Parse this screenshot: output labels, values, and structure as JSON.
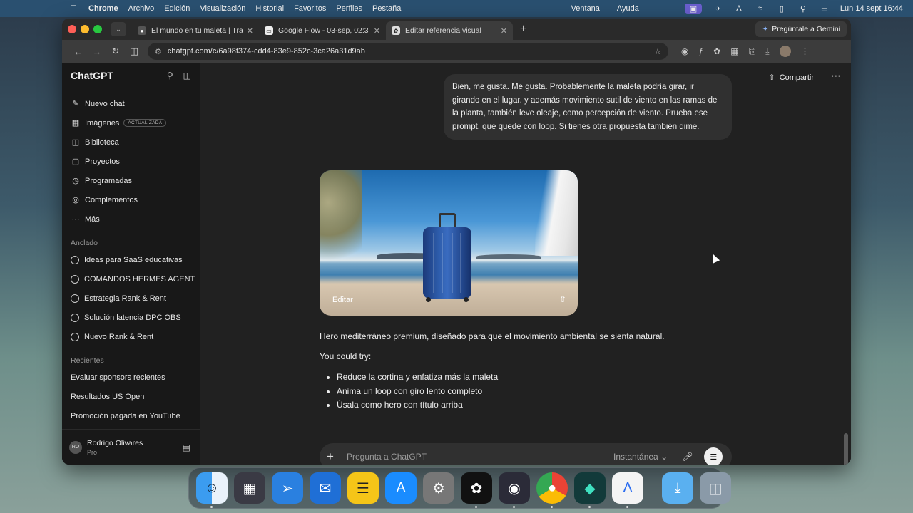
{
  "menubar": {
    "app": "Chrome",
    "items": [
      "Archivo",
      "Edición",
      "Visualización",
      "Historial",
      "Favoritos",
      "Perfiles",
      "Pestaña",
      "Ventana",
      "Ayuda"
    ],
    "clock": "Lun 14 sept  16:44"
  },
  "browser": {
    "tabs": [
      {
        "title": "El mundo en tu maleta | Trave",
        "favicon": "globe-icon"
      },
      {
        "title": "Google Flow - 03-sep, 02:33",
        "favicon": "flow-icon"
      },
      {
        "title": "Editar referencia visual",
        "favicon": "chatgpt-icon"
      }
    ],
    "gemini_label": "Pregúntale a Gemini",
    "url": "chatgpt.com/c/6a98f374-cdd4-83e9-852c-3ca26a31d9ab"
  },
  "sidebar": {
    "logo": "ChatGPT",
    "nav": [
      {
        "label": "Nuevo chat",
        "icon": "edit-icon"
      },
      {
        "label": "Imágenes",
        "icon": "images-icon",
        "badge": "ACTUALIZADA"
      },
      {
        "label": "Biblioteca",
        "icon": "library-icon"
      },
      {
        "label": "Proyectos",
        "icon": "folder-icon"
      },
      {
        "label": "Programadas",
        "icon": "clock-icon"
      },
      {
        "label": "Complementos",
        "icon": "plugin-icon"
      },
      {
        "label": "Más",
        "icon": "more-icon"
      }
    ],
    "pinned_title": "Anclado",
    "pinned": [
      "Ideas para SaaS educativas",
      "COMANDOS HERMES AGENT",
      "Estrategia Rank & Rent",
      "Solución latencia DPC OBS",
      "Nuevo Rank & Rent"
    ],
    "recent_title": "Recientes",
    "recent": [
      "Evaluar sponsors recientes",
      "Resultados US Open",
      "Promoción pagada en YouTube"
    ],
    "user": {
      "initials": "RO",
      "name": "Rodrigo Olivares",
      "plan": "Pro"
    }
  },
  "chat": {
    "share_label": "Compartir",
    "user_message": "Bien, me gusta. Me gusta. Probablemente la maleta podría girar, ir girando en el lugar. y además movimiento sutil de viento en las ramas de la planta, también leve oleaje, como percepción de viento. Prueba ese prompt, que quede con loop. Si tienes otra propuesta también dime.",
    "image_edit_label": "Editar",
    "assistant_intro": "Hero mediterráneo premium, diseñado para que el movimiento ambiental se sienta natural.",
    "assistant_try": "You could try:",
    "suggestions": [
      "Reduce la cortina y enfatiza más la maleta",
      "Anima un loop con giro lento completo",
      "Úsala como hero con título arriba"
    ]
  },
  "composer": {
    "placeholder": "Pregunta a ChatGPT",
    "model": "Instantánea"
  },
  "dock": [
    "Finder",
    "Launchpad",
    "Safari",
    "Mail",
    "Notes",
    "App Store",
    "System Settings",
    "ChatGPT",
    "OBS",
    "Chrome",
    "Filmora",
    "Arc",
    "Downloads",
    "Trash"
  ]
}
